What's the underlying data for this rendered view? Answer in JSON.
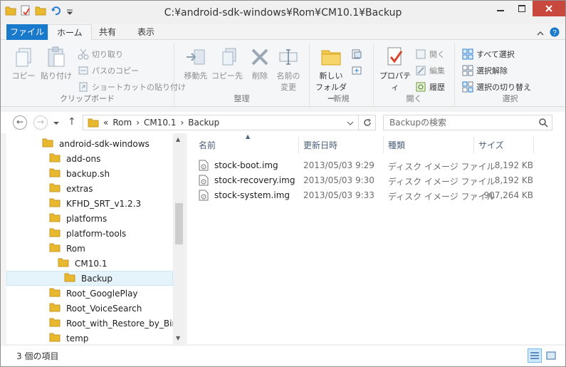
{
  "window": {
    "title": "C:¥android-sdk-windows¥Rom¥CM10.1¥Backup",
    "minimize_icon": "minimize-icon",
    "maximize_icon": "maximize-icon",
    "close_icon": "close-icon"
  },
  "ribbon_tabs": [
    "ファイル",
    "ホーム",
    "共有",
    "表示"
  ],
  "ribbon": {
    "clipboard": {
      "label": "クリップボード",
      "copy": "コピー",
      "paste": "貼り付け",
      "cut": "切り取り",
      "copy_path": "パスのコピー",
      "paste_shortcut": "ショートカットの貼り付け"
    },
    "organize": {
      "label": "整理",
      "move_to": "移動先",
      "copy_to": "コピー先",
      "delete": "削除",
      "rename_line1": "名前の",
      "rename_line2": "変更"
    },
    "new": {
      "label": "新規",
      "new_folder_line1": "新しい",
      "new_folder_line2": "フォルダー"
    },
    "open": {
      "label": "開く",
      "properties": "プロパティ",
      "open": "開く",
      "edit": "編集",
      "history": "履歴"
    },
    "select": {
      "label": "選択",
      "select_all": "すべて選択",
      "select_none": "選択解除",
      "invert": "選択の切り替え"
    }
  },
  "address": {
    "prefix": "«",
    "crumbs": [
      "Rom",
      "CM10.1",
      "Backup"
    ]
  },
  "search": {
    "placeholder": "Backupの検索"
  },
  "tree": [
    {
      "label": "android-sdk-windows",
      "level": 0
    },
    {
      "label": "add-ons",
      "level": 1
    },
    {
      "label": "backup.sh",
      "level": 1
    },
    {
      "label": "extras",
      "level": 1
    },
    {
      "label": "KFHD_SRT_v1.2.3",
      "level": 1
    },
    {
      "label": "platforms",
      "level": 1
    },
    {
      "label": "platform-tools",
      "level": 1
    },
    {
      "label": "Rom",
      "level": 1
    },
    {
      "label": "CM10.1",
      "level": 2
    },
    {
      "label": "Backup",
      "level": 3,
      "selected": true
    },
    {
      "label": "Root_GooglePlay",
      "level": 1
    },
    {
      "label": "Root_VoiceSearch",
      "level": 1
    },
    {
      "label": "Root_with_Restore_by_Bin",
      "level": 1
    },
    {
      "label": "temp",
      "level": 1
    }
  ],
  "columns": [
    "名前",
    "更新日時",
    "種類",
    "サイズ"
  ],
  "files": [
    {
      "name": "stock-boot.img",
      "date": "2013/05/03 9:29",
      "type": "ディスク イメージ ファイル",
      "size": "8,192 KB"
    },
    {
      "name": "stock-recovery.img",
      "date": "2013/05/03 9:30",
      "type": "ディスク イメージ ファイル",
      "size": "8,192 KB"
    },
    {
      "name": "stock-system.img",
      "date": "2013/05/03 9:33",
      "type": "ディスク イメージ ファイル",
      "size": "907,264 KB"
    }
  ],
  "status": {
    "item_count": "3 個の項目"
  },
  "colors": {
    "file_tab": "#1979ca",
    "close_button": "#c9483e",
    "folder": "#e8b92f",
    "selection": "#e5f3fb"
  }
}
